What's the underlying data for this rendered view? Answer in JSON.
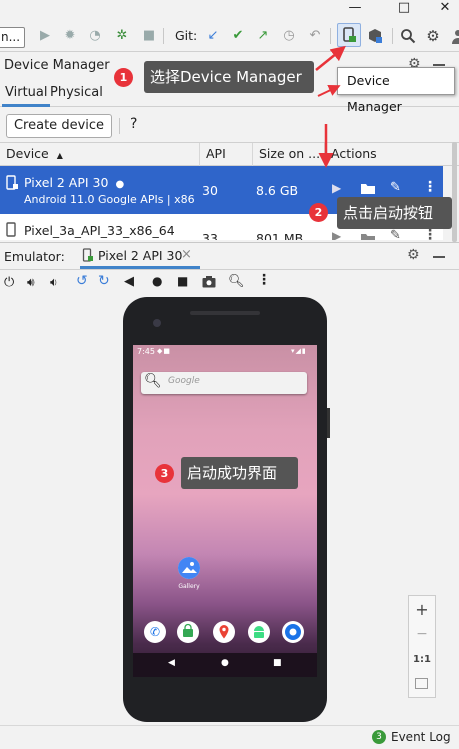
{
  "window": {
    "minimize": "—",
    "maximize": "□",
    "close": "✕"
  },
  "toolbar": {
    "run_config": "n...",
    "git_label": "Git:"
  },
  "device_manager": {
    "title": "Device Manager",
    "tabs": [
      "Virtual",
      "Physical"
    ],
    "create_button": "Create device",
    "help": "?",
    "columns": {
      "device": "Device",
      "api": "API",
      "size": "Size on ...",
      "actions": "Actions"
    },
    "devices": [
      {
        "name": "Pixel 2 API 30",
        "detail": "Android 11.0 Google APIs | x86",
        "api": "30",
        "size": "8.6 GB",
        "selected": true
      },
      {
        "name": "Pixel_3a_API_33_x86_64",
        "detail": "",
        "api": "33",
        "size": "801 MB",
        "selected": false
      }
    ]
  },
  "emulator": {
    "label": "Emulator:",
    "tab": "Pixel 2 API 30",
    "tab_close": "×"
  },
  "phone": {
    "time": "7:45",
    "search_placeholder": "Google",
    "app_label": "Gallery"
  },
  "side_panel": {
    "zoom_in": "+",
    "zoom_out": "−",
    "ratio": "1:1"
  },
  "statusbar": {
    "event_count": "3",
    "event_log": "Event Log"
  },
  "annotations": [
    {
      "num": "1",
      "text": "选择Device Manager"
    },
    {
      "num": "2",
      "text": "点击启动按钮"
    },
    {
      "num": "3",
      "text": "启动成功界面"
    }
  ],
  "tooltip": "Device Manager",
  "colors": {
    "selection": "#2f65ca",
    "marker": "#e8333a",
    "arrow": "#e8333a",
    "callout": "#555555"
  }
}
